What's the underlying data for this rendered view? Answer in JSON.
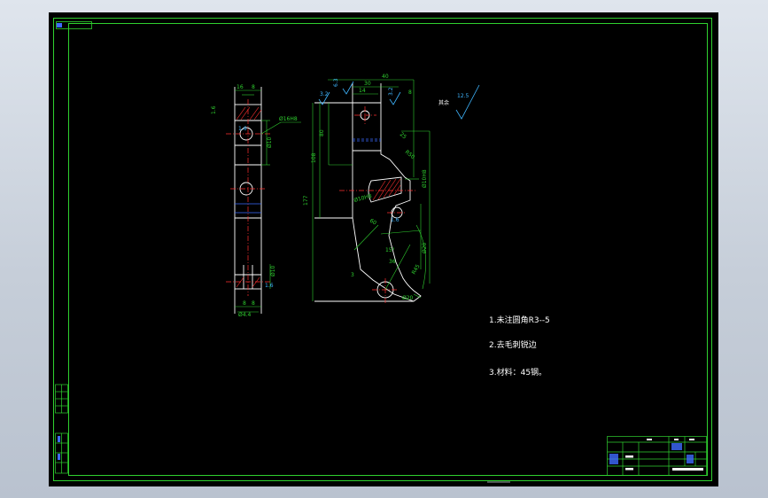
{
  "drawing": {
    "notes": [
      "1.未注圆角R3--5",
      "2.去毛刺锐边",
      "3.材料：45钢。"
    ],
    "roughness": {
      "main": "12.5",
      "remaining": "其余",
      "r1": "3.2",
      "r2": "6.3",
      "r3": "3.2",
      "r4": "1.6",
      "r5": "1.6"
    },
    "dims_side": [
      "16",
      "8",
      "Ø16H8",
      "Ø10",
      "16",
      "Ø10",
      "8",
      "8",
      "Ø4.4"
    ],
    "dims_main": [
      "40",
      "30",
      "14",
      "8",
      "25",
      "80",
      "108",
      "177",
      "R50",
      "R45",
      "Ø10H8",
      "Ø20",
      "60",
      "36",
      "15°",
      "3"
    ],
    "colors": {
      "frame": "#2fd12f",
      "lines": "#ffffff",
      "center": "#ff3030",
      "hidden": "#3a6bff",
      "dim": "#2fd12f",
      "accent": "#3fb6ff"
    }
  }
}
